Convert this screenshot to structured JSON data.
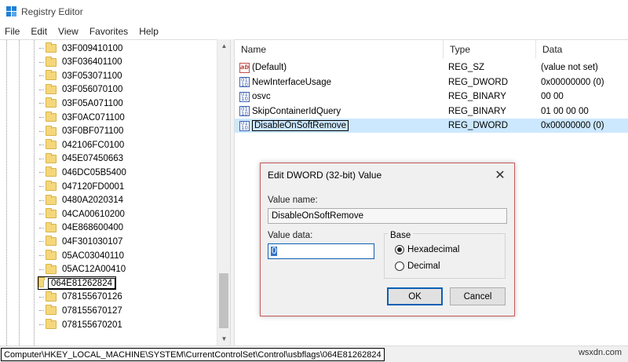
{
  "window": {
    "title": "Registry Editor"
  },
  "menu": [
    "File",
    "Edit",
    "View",
    "Favorites",
    "Help"
  ],
  "tree": {
    "items": [
      "03F009410100",
      "03F036401100",
      "03F053071100",
      "03F056070100",
      "03F05A071100",
      "03F0AC071100",
      "03F0BF071100",
      "042106FC0100",
      "045E07450663",
      "046DC05B5400",
      "047120FD0001",
      "0480A2020314",
      "04CA00610200",
      "04E868600400",
      "04F301030107",
      "05AC03040110",
      "05AC12A00410",
      "064E81262824",
      "078155670126",
      "078155670127",
      "078155670201"
    ],
    "selected": "064E81262824"
  },
  "values": {
    "columns": [
      "Name",
      "Type",
      "Data"
    ],
    "rows": [
      {
        "icon": "string-value-icon",
        "glyph": "ab",
        "name": "(Default)",
        "type": "REG_SZ",
        "data": "(value not set)"
      },
      {
        "icon": "binary-value-icon",
        "glyph": "0110",
        "name": "NewInterfaceUsage",
        "type": "REG_DWORD",
        "data": "0x00000000 (0)"
      },
      {
        "icon": "binary-value-icon",
        "glyph": "0110",
        "name": "osvc",
        "type": "REG_BINARY",
        "data": "00 00"
      },
      {
        "icon": "binary-value-icon",
        "glyph": "0110",
        "name": "SkipContainerIdQuery",
        "type": "REG_BINARY",
        "data": "01 00 00 00"
      },
      {
        "icon": "binary-value-icon",
        "glyph": "0110",
        "name": "DisableOnSoftRemove",
        "type": "REG_DWORD",
        "data": "0x00000000 (0)"
      }
    ],
    "selected_index": 4
  },
  "dialog": {
    "title": "Edit DWORD (32-bit) Value",
    "value_name_label": "Value name:",
    "value_name": "DisableOnSoftRemove",
    "value_data_label": "Value data:",
    "value_data": "0",
    "base_label": "Base",
    "radio_hex": "Hexadecimal",
    "radio_dec": "Decimal",
    "base_selected": "Hexadecimal",
    "ok": "OK",
    "cancel": "Cancel",
    "close_glyph": "✕"
  },
  "statusbar": {
    "path": "Computer\\HKEY_LOCAL_MACHINE\\SYSTEM\\CurrentControlSet\\Control\\usbflags\\064E81262824",
    "watermark": "wsxdn.com"
  },
  "colors": {
    "selection": "#cce8ff",
    "accent": "#0b5fb5",
    "folder": "#f5d77b",
    "dialog_border": "#c75b5b"
  }
}
